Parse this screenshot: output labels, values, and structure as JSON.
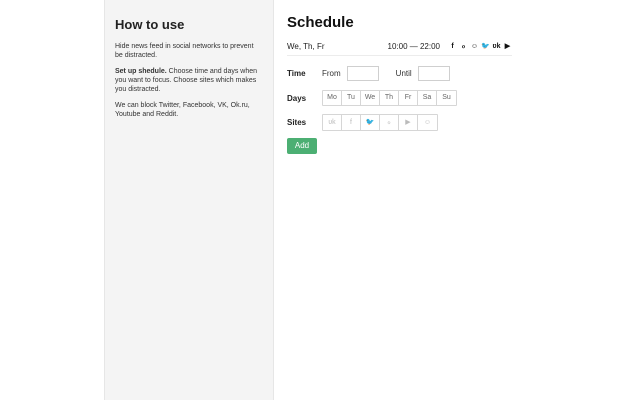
{
  "help": {
    "title": "How to use",
    "para1": "Hide news feed in social networks to prevent be distracted.",
    "para2_bold": "Set up shedule.",
    "para2_rest": " Choose time and days when you want to focus. Choose sites which makes you distracted.",
    "para3": "We can block Twitter, Facebook, VK, Ok.ru, Youtube and Reddit."
  },
  "schedule": {
    "title": "Schedule",
    "entry": {
      "days": "We, Th, Fr",
      "time": "10:00 — 22:00",
      "icons": [
        {
          "name": "facebook-icon",
          "glyph": "f"
        },
        {
          "name": "odnoklassniki-icon",
          "glyph": "ℴ"
        },
        {
          "name": "reddit-icon",
          "glyph": "☺"
        },
        {
          "name": "twitter-icon",
          "glyph": "🐦"
        },
        {
          "name": "vk-icon",
          "glyph": "ʋk"
        },
        {
          "name": "youtube-icon",
          "glyph": "▶"
        }
      ]
    }
  },
  "form": {
    "time_label": "Time",
    "from_label": "From",
    "until_label": "Until",
    "from_value": "",
    "until_value": "",
    "days_label": "Days",
    "days": [
      "Mo",
      "Tu",
      "We",
      "Th",
      "Fr",
      "Sa",
      "Su"
    ],
    "sites_label": "Sites",
    "sites": [
      {
        "name": "vk-icon",
        "glyph": "ʋk"
      },
      {
        "name": "facebook-icon",
        "glyph": "f"
      },
      {
        "name": "twitter-icon",
        "glyph": "🐦"
      },
      {
        "name": "odnoklassniki-icon",
        "glyph": "ℴ"
      },
      {
        "name": "youtube-icon",
        "glyph": "▶"
      },
      {
        "name": "reddit-icon",
        "glyph": "☺"
      }
    ],
    "add_label": "Add"
  },
  "colors": {
    "accent": "#4caf73",
    "panel_bg": "#f4f4f4"
  }
}
